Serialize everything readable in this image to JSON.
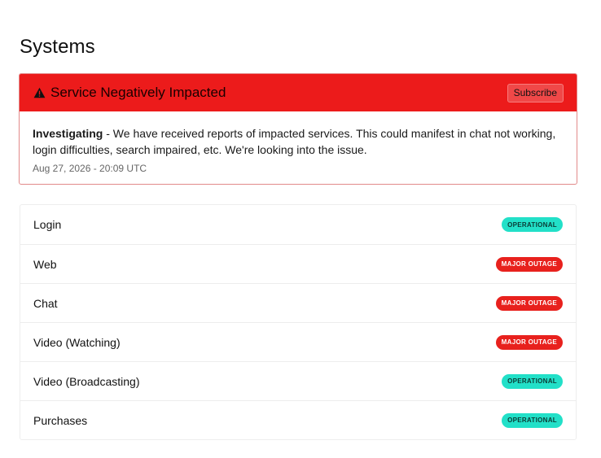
{
  "page": {
    "title": "Systems"
  },
  "incident": {
    "title": "Service Negatively Impacted",
    "icon": "warning-icon",
    "subscribe_label": "Subscribe",
    "status": "Investigating",
    "message": " - We have received reports of impacted services.  This could manifest in chat not working, login difficulties, search impaired, etc.  We're looking into the issue.",
    "timestamp": "Aug 27, 2026 - 20:09 UTC",
    "colors": {
      "banner": "#ec1b1b",
      "border": "#e28a8a"
    }
  },
  "systems": [
    {
      "name": "Login",
      "status": "OPERATIONAL",
      "state": "operational"
    },
    {
      "name": "Web",
      "status": "MAJOR OUTAGE",
      "state": "outage"
    },
    {
      "name": "Chat",
      "status": "MAJOR OUTAGE",
      "state": "outage"
    },
    {
      "name": "Video (Watching)",
      "status": "MAJOR OUTAGE",
      "state": "outage"
    },
    {
      "name": "Video (Broadcasting)",
      "status": "OPERATIONAL",
      "state": "operational"
    },
    {
      "name": "Purchases",
      "status": "OPERATIONAL",
      "state": "operational"
    }
  ],
  "status_colors": {
    "operational": "#22e0c8",
    "outage": "#e8211d"
  }
}
